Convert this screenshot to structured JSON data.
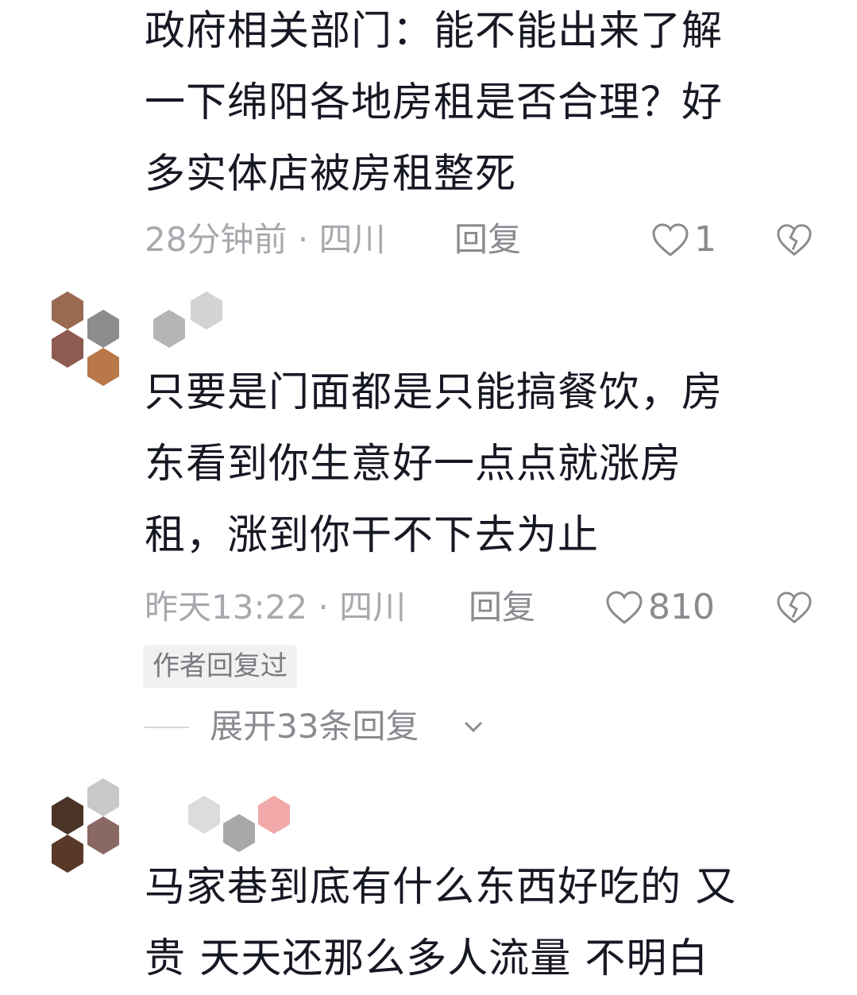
{
  "comments": [
    {
      "lines": [
        "政府相关部门：能不能出来了解",
        "一下绵阳各地房租是否合理？好",
        "多实体店被房租整死"
      ],
      "time_location": "28分钟前 · 四川",
      "reply_label": "回复",
      "like_count": "1"
    },
    {
      "lines": [
        "只要是门面都是只能搞餐饮，房",
        "东看到你生意好一点点就涨房",
        "租，涨到你干不下去为止"
      ],
      "time_location": "昨天13:22 · 四川",
      "reply_label": "回复",
      "like_count": "810",
      "author_badge": "作者回复过",
      "expand_label": "展开33条回复"
    },
    {
      "lines": [
        "马家巷到底有什么东西好吃的  又",
        "贵  天天还那么多人流量  不明白"
      ]
    }
  ],
  "icons": {
    "like": "heart-outline-icon",
    "dislike": "broken-heart-icon",
    "expand": "chevron-down-icon"
  }
}
